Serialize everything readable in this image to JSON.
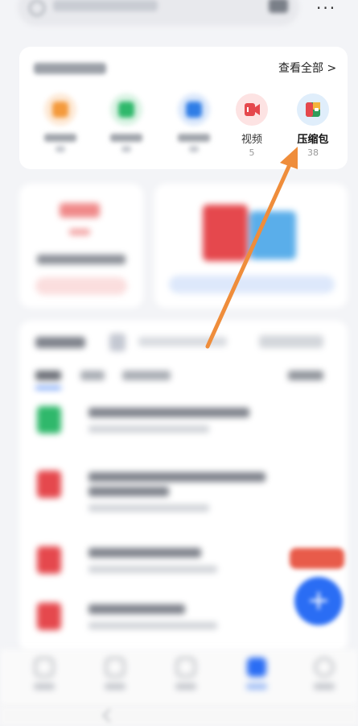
{
  "header": {
    "more_label": "···"
  },
  "categories": {
    "view_all_label": "查看全部 >",
    "items": [
      {
        "label": "",
        "count": "",
        "icon": "download-icon",
        "color": "#f49a3c"
      },
      {
        "label": "",
        "count": "",
        "icon": "chat-icon",
        "color": "#2fb86b"
      },
      {
        "label": "",
        "count": "",
        "icon": "image-icon",
        "color": "#2f7de6"
      },
      {
        "label": "视频",
        "count": "5",
        "icon": "video-icon",
        "color": "#e5484d"
      },
      {
        "label": "压缩包",
        "count": "38",
        "icon": "zip-package-icon",
        "color": "#2f8fd6"
      }
    ]
  },
  "accent": {
    "arrow_color": "#ef8d3b",
    "fab_color": "#2a6df4"
  },
  "fab": {
    "label": "+"
  }
}
